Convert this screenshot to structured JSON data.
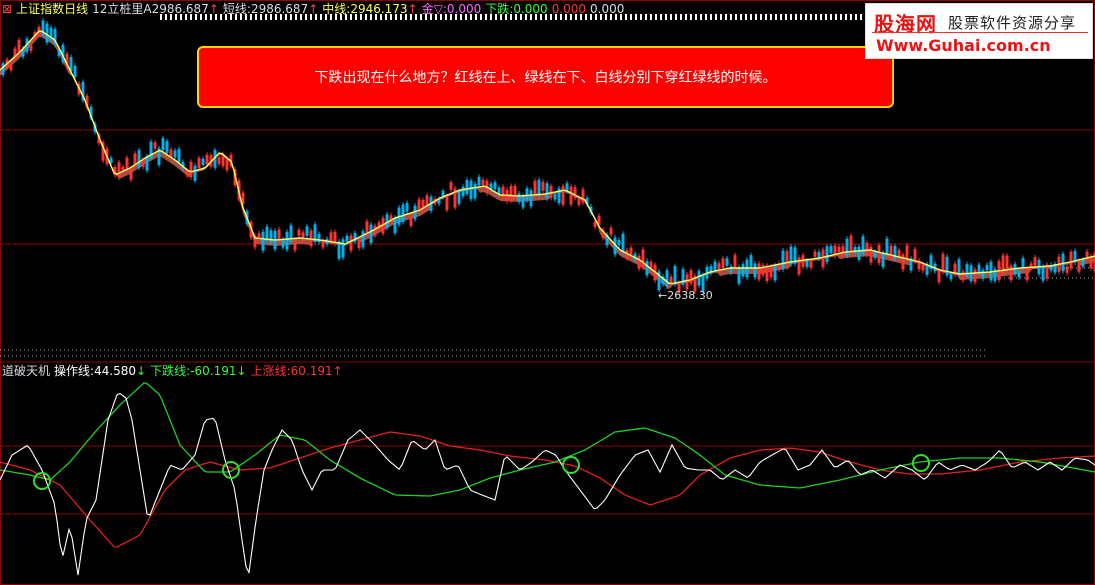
{
  "top_panel": {
    "title": "上证指数日线",
    "indicator_name": "12立桩里A",
    "value_a": "2986.687",
    "arrow_a": "↑",
    "short_label": "短线:",
    "short_value": "2986.687",
    "arrow_short": "↑",
    "mid_label": "中线:",
    "mid_value": "2946.173",
    "arrow_mid": "↑",
    "gold_label": "金▽:",
    "gold_value": "0.000",
    "down_label": "下跌:",
    "down_value": "0.000",
    "extra_value_1": "0.000",
    "extra_value_2": "0.000",
    "low_marker": "←2638.30"
  },
  "callout": {
    "text": "下跌出现在什么地方？红线在上、绿线在下、白线分别下穿红绿线的时候。"
  },
  "logo": {
    "brand_cn": "股海网",
    "slogan": "股票软件资源分享",
    "url": "Www.Guhai.com.cn"
  },
  "bottom_panel": {
    "title": "道破天机",
    "op_label": "操作线:",
    "op_value": "44.580",
    "op_arrow": "↓",
    "down_label": "下跌线:",
    "down_value": "-60.191",
    "down_arrow": "↓",
    "up_label": "上涨线:",
    "up_value": "60.191",
    "up_arrow": "↑"
  },
  "colors": {
    "background": "#000000",
    "up_candle": "#ff3232",
    "down_candle": "#00b0e8",
    "ma_line": "#ffff66",
    "band_fill": "#c85a4a",
    "red_line": "#e02020",
    "green_line": "#20d020",
    "white_line": "#ffffff",
    "grid": "#8a0000",
    "callout_bg": "#ff0000",
    "callout_border": "#ffd400",
    "circle": "#33dd33"
  }
}
